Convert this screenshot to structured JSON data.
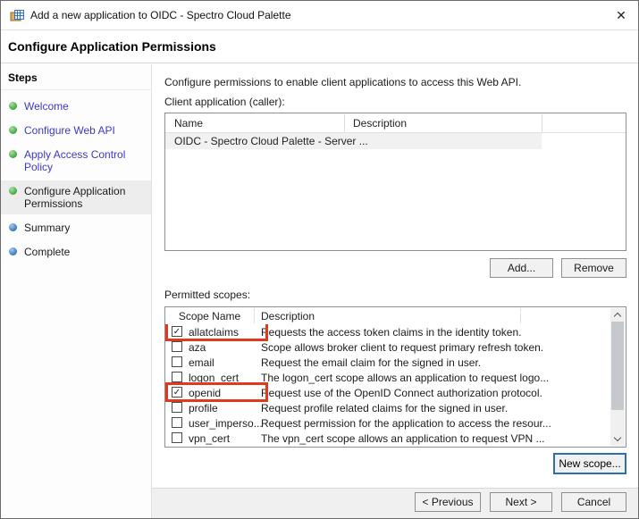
{
  "window": {
    "title": "Add a new application to OIDC - Spectro Cloud Palette",
    "close_glyph": "✕"
  },
  "header": {
    "title": "Configure Application Permissions"
  },
  "steps": {
    "label": "Steps",
    "items": [
      {
        "label": "Welcome",
        "state": "done"
      },
      {
        "label": "Configure Web API",
        "state": "done"
      },
      {
        "label": "Apply Access Control Policy",
        "state": "done"
      },
      {
        "label": "Configure Application Permissions",
        "state": "current"
      },
      {
        "label": "Summary",
        "state": "upcoming"
      },
      {
        "label": "Complete",
        "state": "upcoming"
      }
    ]
  },
  "main": {
    "intro": "Configure permissions to enable client applications to access this Web API.",
    "client_section": {
      "label": "Client application (caller):",
      "columns": [
        "Name",
        "Description"
      ],
      "rows": [
        {
          "name": "OIDC - Spectro Cloud Palette - Server ...",
          "description": ""
        }
      ],
      "add_button": "Add...",
      "remove_button": "Remove"
    },
    "scopes_section": {
      "label": "Permitted scopes:",
      "columns": [
        "Scope Name",
        "Description"
      ],
      "rows": [
        {
          "name": "allatclaims",
          "checked": true,
          "highlighted": true,
          "description": "Requests the access token claims in the identity token."
        },
        {
          "name": "aza",
          "checked": false,
          "highlighted": false,
          "description": "Scope allows broker client to request primary refresh token."
        },
        {
          "name": "email",
          "checked": false,
          "highlighted": false,
          "description": "Request the email claim for the signed in user."
        },
        {
          "name": "logon_cert",
          "checked": false,
          "highlighted": false,
          "description": "The logon_cert scope allows an application to request logo..."
        },
        {
          "name": "openid",
          "checked": true,
          "highlighted": true,
          "description": "Request use of the OpenID Connect authorization protocol."
        },
        {
          "name": "profile",
          "checked": false,
          "highlighted": false,
          "description": "Request profile related claims for the signed in user."
        },
        {
          "name": "user_imperso...",
          "checked": false,
          "highlighted": false,
          "description": "Request permission for the application to access the resour..."
        },
        {
          "name": "vpn_cert",
          "checked": false,
          "highlighted": false,
          "description": "The vpn_cert scope allows an application to request VPN ..."
        }
      ],
      "new_scope_button": "New scope..."
    }
  },
  "footer": {
    "previous_button": "< Previous",
    "next_button": "Next >",
    "cancel_button": "Cancel"
  },
  "icons": {
    "app_icon": "adfs-application-box",
    "checkmark": "✓",
    "scroll_up": "chevron-up",
    "scroll_down": "chevron-down",
    "step_bullet": "sphere"
  },
  "colors": {
    "annotation_red": "#e1391c",
    "step_link": "#3a3ac4",
    "focus_border": "#2f6ead",
    "bullet_done": "#39a339",
    "bullet_upcoming": "#2e73b8"
  }
}
